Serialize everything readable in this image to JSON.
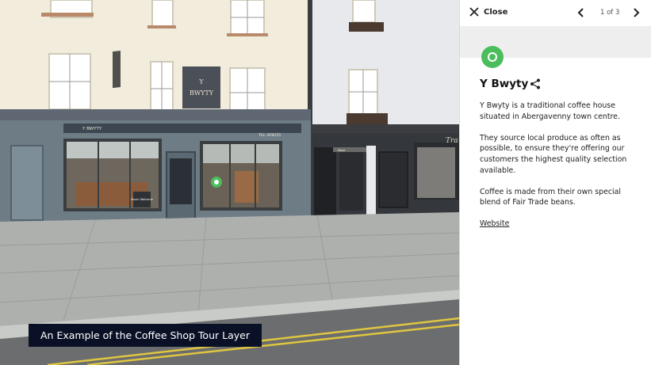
{
  "scene": {
    "caption": "An Example of the Coffee Shop Tour Layer",
    "sign_main_line1": "Y",
    "sign_main_line2": "BWYTY",
    "fascia_name": "Y BWYTY",
    "fascia_tel": "TEL: 858255",
    "fascia_right": "Tra",
    "door_label": "Mexe",
    "window_label": "Pooch Welcome",
    "hotspot_color": "#4cbd5c"
  },
  "panel": {
    "close_label": "Close",
    "counter": "1 of 3",
    "title": "Y Bwyty",
    "paragraphs": [
      "Y Bwyty is a traditional coffee house situated in Abergavenny town centre.",
      "They source local produce as often as possible, to ensure they're offering our customers the highest quality selection available.",
      "Coffee is made from their own special blend of Fair Trade beans."
    ],
    "website_label": "Website",
    "accent_color": "#4cbd5c"
  }
}
